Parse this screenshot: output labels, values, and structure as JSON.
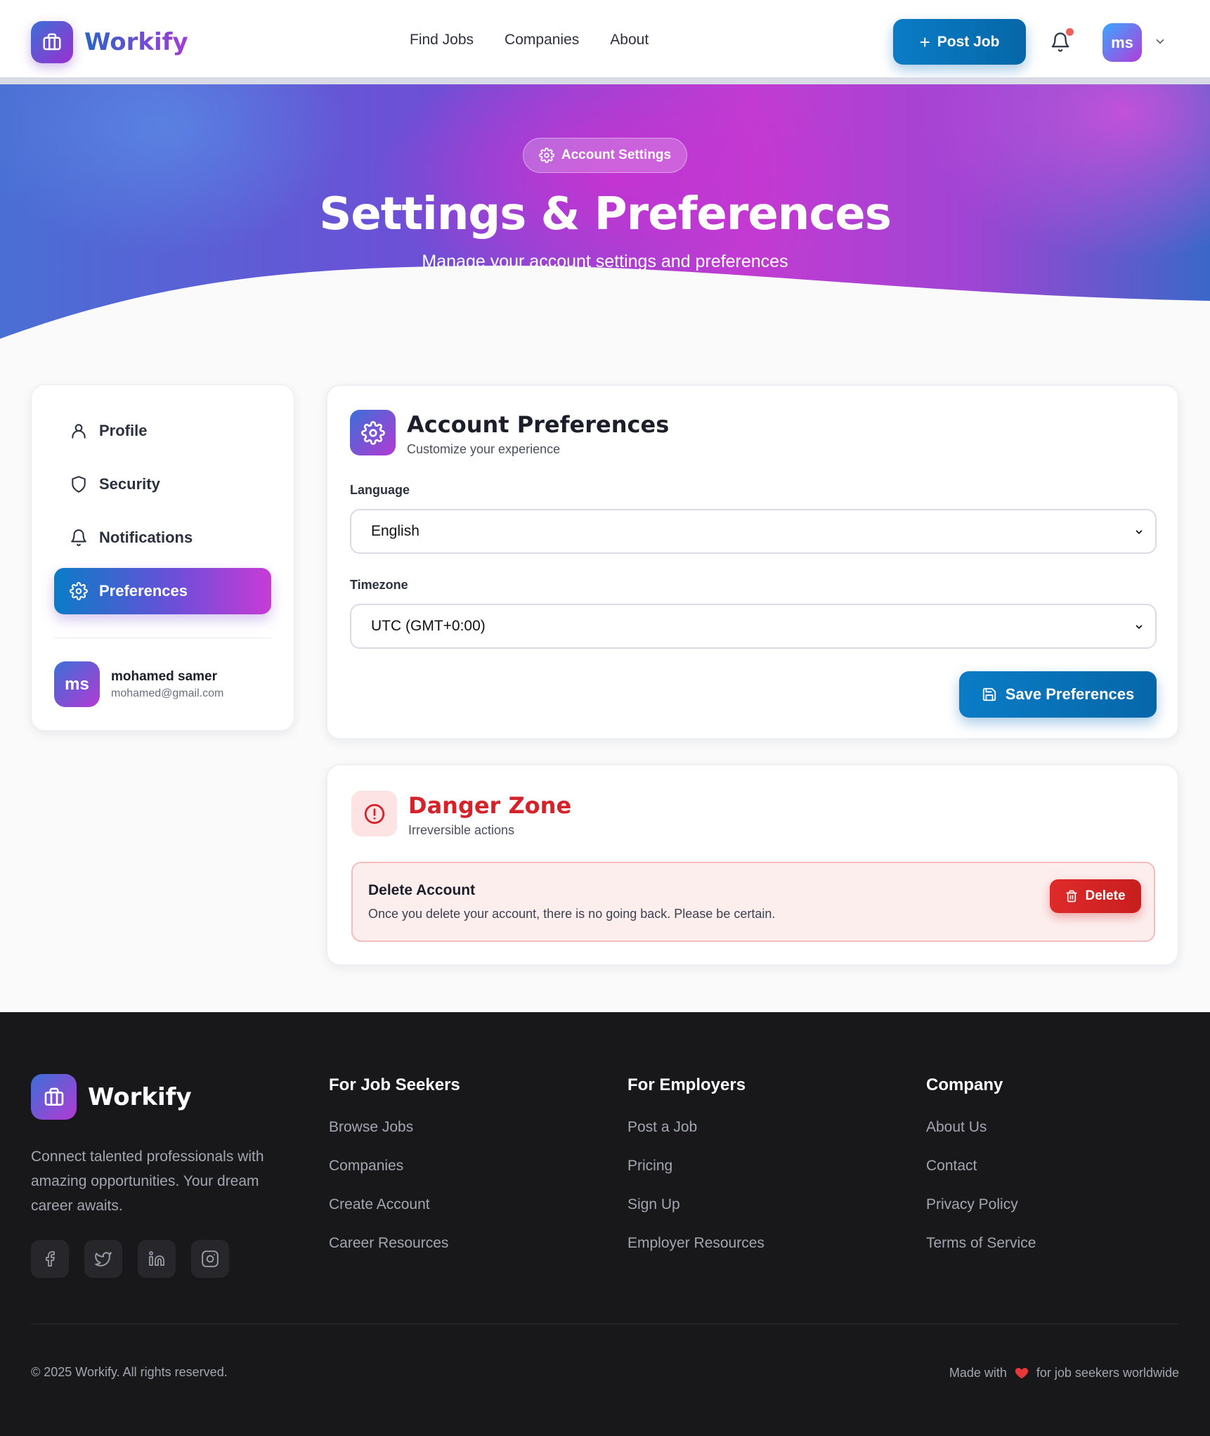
{
  "header": {
    "brand": "Workify",
    "nav": [
      "Find Jobs",
      "Companies",
      "About"
    ],
    "post_job_label": "Post Job",
    "avatar_initials": "ms",
    "has_notification": true
  },
  "hero": {
    "badge": "Account Settings",
    "title": "Settings & Preferences",
    "subtitle": "Manage your account settings and preferences"
  },
  "sidebar": {
    "items": [
      {
        "label": "Profile",
        "icon": "user-icon"
      },
      {
        "label": "Security",
        "icon": "shield-icon"
      },
      {
        "label": "Notifications",
        "icon": "bell-icon"
      },
      {
        "label": "Preferences",
        "icon": "gear-icon",
        "active": true
      }
    ],
    "user": {
      "initials": "ms",
      "name": "mohamed samer",
      "email": "mohamed@gmail.com"
    }
  },
  "preferences": {
    "title": "Account Preferences",
    "subtitle": "Customize your experience",
    "language_label": "Language",
    "language_value": "English",
    "timezone_label": "Timezone",
    "timezone_value": "UTC (GMT+0:00)",
    "save_label": "Save Preferences"
  },
  "danger": {
    "title": "Danger Zone",
    "subtitle": "Irreversible actions",
    "box_title": "Delete Account",
    "box_text": "Once you delete your account, there is no going back. Please be certain.",
    "delete_label": "Delete"
  },
  "footer": {
    "brand": "Workify",
    "description": "Connect talented professionals with amazing opportunities. Your dream career awaits.",
    "social": [
      "facebook-icon",
      "twitter-icon",
      "linkedin-icon",
      "instagram-icon"
    ],
    "columns": [
      {
        "title": "For Job Seekers",
        "links": [
          "Browse Jobs",
          "Companies",
          "Create Account",
          "Career Resources"
        ]
      },
      {
        "title": "For Employers",
        "links": [
          "Post a Job",
          "Pricing",
          "Sign Up",
          "Employer Resources"
        ]
      },
      {
        "title": "Company",
        "links": [
          "About Us",
          "Contact",
          "Privacy Policy",
          "Terms of Service"
        ]
      }
    ],
    "copyright": "© 2025 Workify. All rights reserved.",
    "made_with_prefix": "Made with",
    "made_with_suffix": "for job seekers worldwide"
  },
  "colors": {
    "primary": "#0a7cc6",
    "accent": "#b33ad4",
    "danger": "#d4242b",
    "footer_bg": "#18181b"
  }
}
